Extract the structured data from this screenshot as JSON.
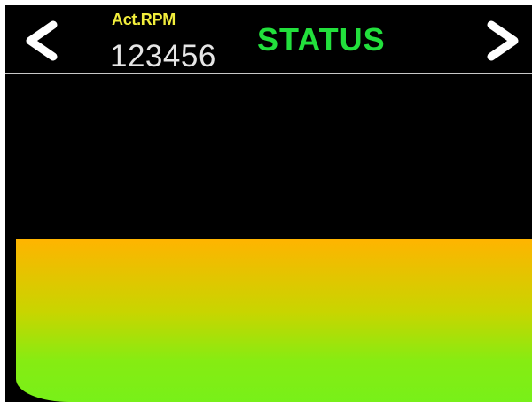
{
  "header": {
    "prev_icon": "chevron-left-icon",
    "next_icon": "chevron-right-icon",
    "rpm_label": "Act.RPM",
    "rpm_value": "123456",
    "status_text": "STATUS"
  },
  "level_gauge": {
    "fill_fraction": 1.0,
    "colors": {
      "top": "#ffb400",
      "bottom": "#78f019"
    }
  },
  "colors": {
    "background": "#000000",
    "rpm_label": "#f2ee3c",
    "rpm_value": "#e6e6e6",
    "status": "#22e03c",
    "divider": "#c8c8c8"
  }
}
